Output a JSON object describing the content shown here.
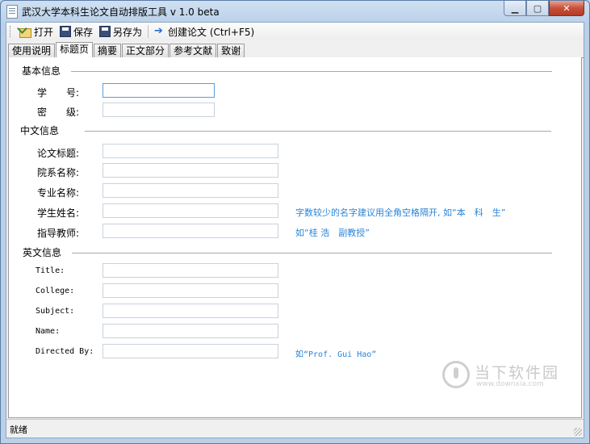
{
  "window": {
    "title": "武汉大学本科生论文自动排版工具 v 1.0 beta"
  },
  "toolbar": {
    "open_label": "打开",
    "save_label": "保存",
    "saveas_label": "另存为",
    "create_label": "创建论文 (Ctrl+F5)"
  },
  "tabs": [
    "使用说明",
    "标题页",
    "摘要",
    "正文部分",
    "参考文献",
    "致谢"
  ],
  "active_tab": "标题页",
  "sections": {
    "basic": {
      "label": "基本信息",
      "student_id": "学　　号:",
      "security": "密　　级:"
    },
    "chinese": {
      "label": "中文信息",
      "title": "论文标题:",
      "dept": "院系名称:",
      "major": "专业名称:",
      "name": "学生姓名:",
      "advisor": "指导教师:"
    },
    "english": {
      "label": "英文信息",
      "title": "Title:",
      "college": "College:",
      "subject": "Subject:",
      "name": "Name:",
      "directed_by": "Directed By:"
    }
  },
  "fields": {
    "student_id": "",
    "security": "",
    "cn_title": "",
    "dept": "",
    "major": "",
    "student_name": "",
    "advisor": "",
    "en_title": "",
    "college": "",
    "subject": "",
    "en_name": "",
    "directed_by": ""
  },
  "hints": {
    "name_hint": "字数较少的名字建议用全角空格隔开, 如“本　科　生”",
    "advisor_hint": "如“桂 浩　副教授”",
    "directed_hint": "如“Prof. Gui Hao”"
  },
  "status": {
    "text": "就绪"
  },
  "watermark": {
    "text": "当下软件园",
    "url": "www.downxia.com"
  }
}
